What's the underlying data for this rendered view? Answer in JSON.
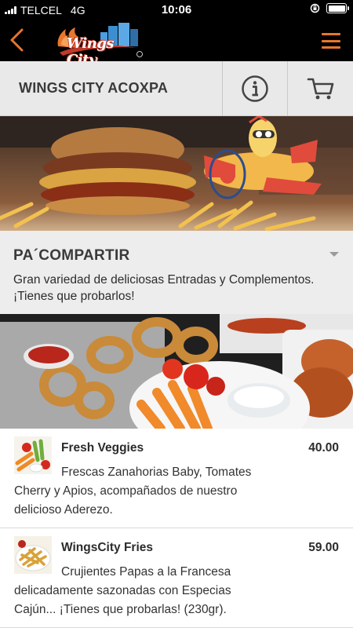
{
  "status_bar": {
    "carrier": "TELCEL",
    "network": "4G",
    "time": "10:06",
    "battery_level": 1.0
  },
  "nav": {
    "logo_text": "Wings City",
    "icons": {
      "back": "chevron-left-icon",
      "menu": "hamburger-menu-icon"
    },
    "accent_color": "#e8762c"
  },
  "store": {
    "name": "WINGS CITY ACOXPA",
    "icons": {
      "info": "info-icon",
      "cart": "cart-icon"
    }
  },
  "section": {
    "title": "PA´COMPARTIR",
    "description": "Gran variedad de deliciosas Entradas y Complementos. ¡Tienes que probarlos!"
  },
  "items": [
    {
      "name": "Fresh Veggies",
      "price": "40.00",
      "description": "Frescas Zanahorias Baby, Tomates Cherry y Apios, acompañados de nuestro delicioso Aderezo."
    },
    {
      "name": "WingsCity Fries",
      "price": "59.00",
      "description": "Crujientes Papas a la Francesa delicadamente sazonadas con Especias Cajún... ¡Tienes que probarlas! (230gr)."
    }
  ]
}
